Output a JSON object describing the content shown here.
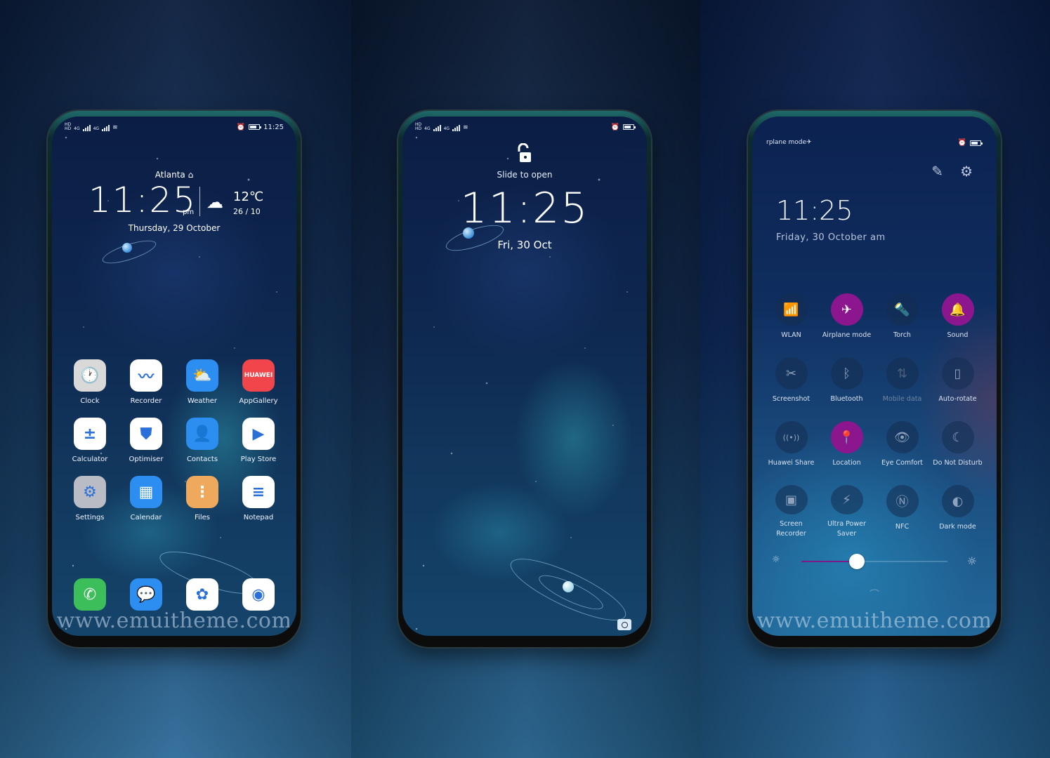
{
  "colors": {
    "accent_purple": "#8b168e",
    "slider_fill": "#7c1c8c",
    "text": "#ffffff"
  },
  "watermark": "www.emuitheme.com",
  "home": {
    "status": {
      "sim1": "HD",
      "sim2": "HD",
      "network1": "4G",
      "network2": "4G",
      "time": "11:25"
    },
    "city": "Atlanta",
    "city_icon": "home-icon",
    "clock": "11:25",
    "ampm": "pm",
    "weather_icon": "cloud-moon-icon",
    "temperature": "12℃",
    "hi_lo": "26 / 10",
    "date": "Thursday, 29 October",
    "apps": [
      {
        "label": "Clock",
        "icon": "clock-icon",
        "glyph": "🕐",
        "bg": "#d9d9d9"
      },
      {
        "label": "Recorder",
        "icon": "recorder-icon",
        "glyph": "〰",
        "bg": "#ffffff"
      },
      {
        "label": "Weather",
        "icon": "weather-icon",
        "glyph": "⛅",
        "bg": "#2b8ef0"
      },
      {
        "label": "AppGallery",
        "icon": "appgallery-icon",
        "glyph": "HUAWEI",
        "bg": "#f0454a"
      },
      {
        "label": "Calculator",
        "icon": "calculator-icon",
        "glyph": "±",
        "bg": "#ffffff"
      },
      {
        "label": "Optimiser",
        "icon": "optimiser-icon",
        "glyph": "⛊",
        "bg": "#ffffff"
      },
      {
        "label": "Contacts",
        "icon": "contacts-icon",
        "glyph": "👤",
        "bg": "#2b8ef0"
      },
      {
        "label": "Play Store",
        "icon": "play-store-icon",
        "glyph": "▶",
        "bg": "#ffffff"
      },
      {
        "label": "Settings",
        "icon": "settings-icon",
        "glyph": "⚙",
        "bg": "#b9bcc4"
      },
      {
        "label": "Calendar",
        "icon": "calendar-icon",
        "glyph": "▦",
        "bg": "#2b8ef0"
      },
      {
        "label": "Files",
        "icon": "files-icon",
        "glyph": "⋮",
        "bg": "#eea95c"
      },
      {
        "label": "Notepad",
        "icon": "notepad-icon",
        "glyph": "≡",
        "bg": "#ffffff"
      }
    ],
    "dock": [
      {
        "label": "Phone",
        "icon": "phone-icon",
        "glyph": "✆",
        "bg": "#3cbf5a"
      },
      {
        "label": "Messages",
        "icon": "messages-icon",
        "glyph": "💬",
        "bg": "#2b8ef0"
      },
      {
        "label": "Gallery",
        "icon": "gallery-icon",
        "glyph": "✿",
        "bg": "#ffffff"
      },
      {
        "label": "Camera",
        "icon": "camera-icon",
        "glyph": "◉",
        "bg": "#ffffff"
      }
    ]
  },
  "lock": {
    "status": {
      "sim1": "HD",
      "sim2": "HD",
      "network1": "4G",
      "network2": "4G"
    },
    "slide_text": "Slide to open",
    "clock": "11:25",
    "date": "Fri, 30 Oct"
  },
  "control": {
    "header_text": "rplane mode",
    "clock": "11:25",
    "date": "Friday, 30 October  am",
    "tiles": [
      {
        "label": "WLAN",
        "icon": "wifi-icon",
        "glyph": "📶",
        "on": false,
        "dim": false
      },
      {
        "label": "Airplane mode",
        "icon": "airplane-icon",
        "glyph": "✈",
        "on": true,
        "dim": false
      },
      {
        "label": "Torch",
        "icon": "torch-icon",
        "glyph": "🔦",
        "on": false,
        "dim": false
      },
      {
        "label": "Sound",
        "icon": "bell-icon",
        "glyph": "🔔",
        "on": true,
        "dim": false
      },
      {
        "label": "Screenshot",
        "icon": "screenshot-icon",
        "glyph": "✂",
        "on": false,
        "dim": false
      },
      {
        "label": "Bluetooth",
        "icon": "bluetooth-icon",
        "glyph": "ᛒ",
        "on": false,
        "dim": false
      },
      {
        "label": "Mobile data",
        "icon": "mobile-data-icon",
        "glyph": "⇅",
        "on": false,
        "dim": true
      },
      {
        "label": "Auto-rotate",
        "icon": "auto-rotate-icon",
        "glyph": "▯",
        "on": false,
        "dim": false
      },
      {
        "label": "Huawei Share",
        "icon": "huawei-share-icon",
        "glyph": "((•))",
        "on": false,
        "dim": false
      },
      {
        "label": "Location",
        "icon": "location-icon",
        "glyph": "📍",
        "on": true,
        "dim": false
      },
      {
        "label": "Eye Comfort",
        "icon": "eye-icon",
        "glyph": "👁",
        "on": false,
        "dim": false
      },
      {
        "label": "Do Not Disturb",
        "icon": "moon-icon",
        "glyph": "☾",
        "on": false,
        "dim": false
      },
      {
        "label": "Screen\nRecorder",
        "icon": "screen-recorder-icon",
        "glyph": "▣",
        "on": false,
        "dim": false
      },
      {
        "label": "Ultra Power\nSaver",
        "icon": "battery-saver-icon",
        "glyph": "⚡",
        "on": false,
        "dim": false
      },
      {
        "label": "NFC",
        "icon": "nfc-icon",
        "glyph": "Ⓝ",
        "on": false,
        "dim": false
      },
      {
        "label": "Dark mode",
        "icon": "dark-mode-icon",
        "glyph": "◐",
        "on": false,
        "dim": false
      }
    ],
    "brightness_percent": 38
  }
}
